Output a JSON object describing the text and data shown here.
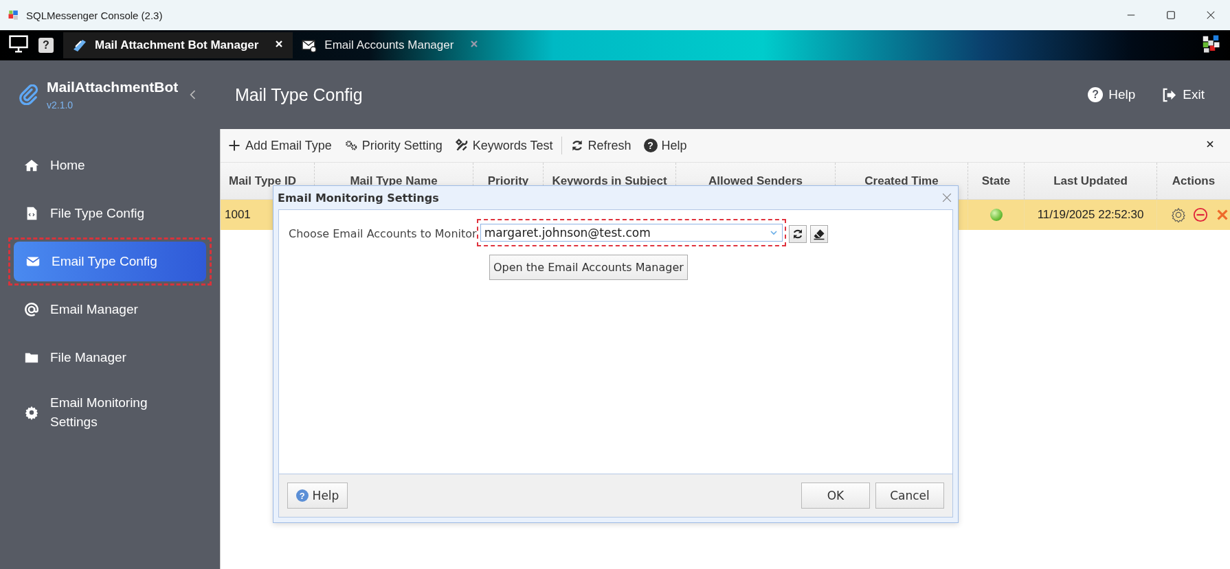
{
  "window": {
    "title": "SQLMessenger Console (2.3)"
  },
  "app_bar": {
    "help_glyph": "?"
  },
  "app_tabs": [
    {
      "label": "Mail Attachment Bot Manager",
      "selected": true
    },
    {
      "label": "Email Accounts Manager",
      "selected": false
    }
  ],
  "sidebar": {
    "app_name": "MailAttachmentBot",
    "version": "v2.1.0",
    "items": [
      {
        "label": "Home",
        "selected": false,
        "highlighted": false
      },
      {
        "label": "File Type Config",
        "selected": false,
        "highlighted": false
      },
      {
        "label": "Email Type Config",
        "selected": true,
        "highlighted": true
      },
      {
        "label": "Email Manager",
        "selected": false,
        "highlighted": false
      },
      {
        "label": "File Manager",
        "selected": false,
        "highlighted": false
      },
      {
        "label": "Email Monitoring Settings",
        "selected": false,
        "highlighted": false
      }
    ]
  },
  "header": {
    "title": "Mail Type Config",
    "help_glyph": "?",
    "help": "Help",
    "exit": "Exit"
  },
  "toolbar": {
    "items": [
      "Add Email Type",
      "Priority Setting",
      "Keywords Test",
      "Refresh",
      "Help"
    ],
    "help_glyph": "?"
  },
  "table": {
    "columns": [
      "Mail Type ID",
      "Mail Type Name",
      "Priority",
      "Keywords in Subject",
      "Allowed Senders",
      "Created Time",
      "State",
      "Last Updated",
      "Actions"
    ],
    "rows": [
      {
        "id": "1001",
        "active": true,
        "last_updated": "11/19/2025 22:52:30",
        "selected": true
      }
    ]
  },
  "dialog": {
    "title": "Email Monitoring Settings",
    "label": "Choose Email Accounts to Monitor",
    "account": "margaret.johnson@test.com",
    "highlighted": true,
    "tooltip": "Open the Email Accounts Manager",
    "help_glyph": "?",
    "help": "Help",
    "ok": "OK",
    "cancel": "Cancel"
  }
}
